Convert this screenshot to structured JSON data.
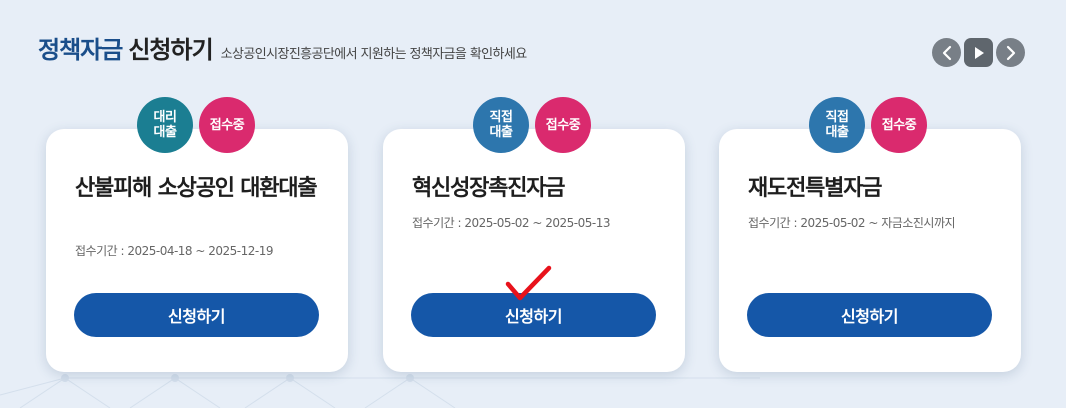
{
  "header": {
    "title_accent": "정책자금",
    "title_rest": "신청하기",
    "subtitle": "소상공인시장진흥공단에서 지원하는 정책자금을 확인하세요"
  },
  "carousel": {
    "prev_icon": "chevron-left-icon",
    "play_icon": "play-icon",
    "next_icon": "chevron-right-icon"
  },
  "cards": [
    {
      "title": "산불피해 소상공인 대환대출",
      "period": "접수기간 : 2025-04-18 ~ 2025-12-19",
      "type_line1": "대리",
      "type_line2": "대출",
      "status": "접수중",
      "button": "신청하기"
    },
    {
      "title": "혁신성장촉진자금",
      "period": "접수기간 : 2025-05-02 ~ 2025-05-13",
      "type_line1": "직접",
      "type_line2": "대출",
      "status": "접수중",
      "button": "신청하기"
    },
    {
      "title": "재도전특별자금",
      "period": "접수기간 : 2025-05-02 ~ 자금소진시까지",
      "type_line1": "직접",
      "type_line2": "대출",
      "status": "접수중",
      "button": "신청하기"
    }
  ],
  "colors": {
    "accent_title": "#1a4e8a",
    "button": "#1557a8",
    "badge_proxy": "#1b7e92",
    "badge_direct": "#2d76ad",
    "badge_status": "#da2a6e",
    "checkmark": "#e8121b"
  }
}
